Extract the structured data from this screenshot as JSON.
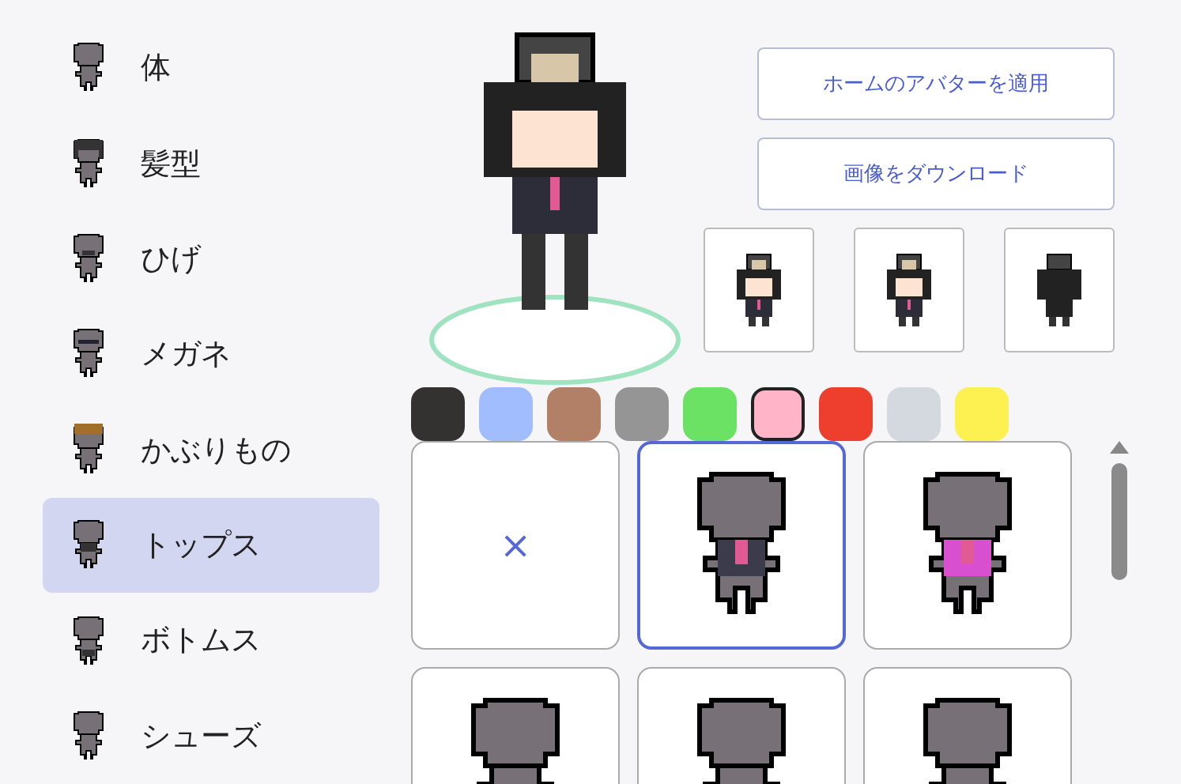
{
  "categories": [
    {
      "label": "体",
      "kind": "body",
      "selected": false
    },
    {
      "label": "髪型",
      "kind": "hair",
      "selected": false
    },
    {
      "label": "ひげ",
      "kind": "beard",
      "selected": false
    },
    {
      "label": "メガネ",
      "kind": "glasses",
      "selected": false
    },
    {
      "label": "かぶりもの",
      "kind": "crown",
      "selected": false
    },
    {
      "label": "トップス",
      "kind": "tops",
      "selected": true
    },
    {
      "label": "ボトムス",
      "kind": "bottoms",
      "selected": false
    },
    {
      "label": "シューズ",
      "kind": "body",
      "selected": false
    }
  ],
  "actions": [
    {
      "label": "ホームのアバターを適用"
    },
    {
      "label": "画像をダウンロード"
    }
  ],
  "views": [
    {
      "kind": "front"
    },
    {
      "kind": "side"
    },
    {
      "kind": "back"
    }
  ],
  "swatches": [
    {
      "color": "#333230",
      "selected": false
    },
    {
      "color": "#a2bdfd",
      "selected": false
    },
    {
      "color": "#b28066",
      "selected": false
    },
    {
      "color": "#959595",
      "selected": false
    },
    {
      "color": "#6ce264",
      "selected": false
    },
    {
      "color": "#ffb5c7",
      "selected": true
    },
    {
      "color": "#ee3f2e",
      "selected": false
    },
    {
      "color": "#d4d9e0",
      "selected": false
    },
    {
      "color": "#fdf051",
      "selected": false
    }
  ],
  "items": [
    {
      "kind": "none",
      "label": "×",
      "selected": false
    },
    {
      "kind": "suit",
      "color": "#3b3b4b",
      "selected": true
    },
    {
      "kind": "suit",
      "color": "#d84fd0",
      "selected": false
    },
    {
      "kind": "plain",
      "selected": false
    },
    {
      "kind": "plain",
      "selected": false
    },
    {
      "kind": "plain",
      "selected": false
    }
  ]
}
